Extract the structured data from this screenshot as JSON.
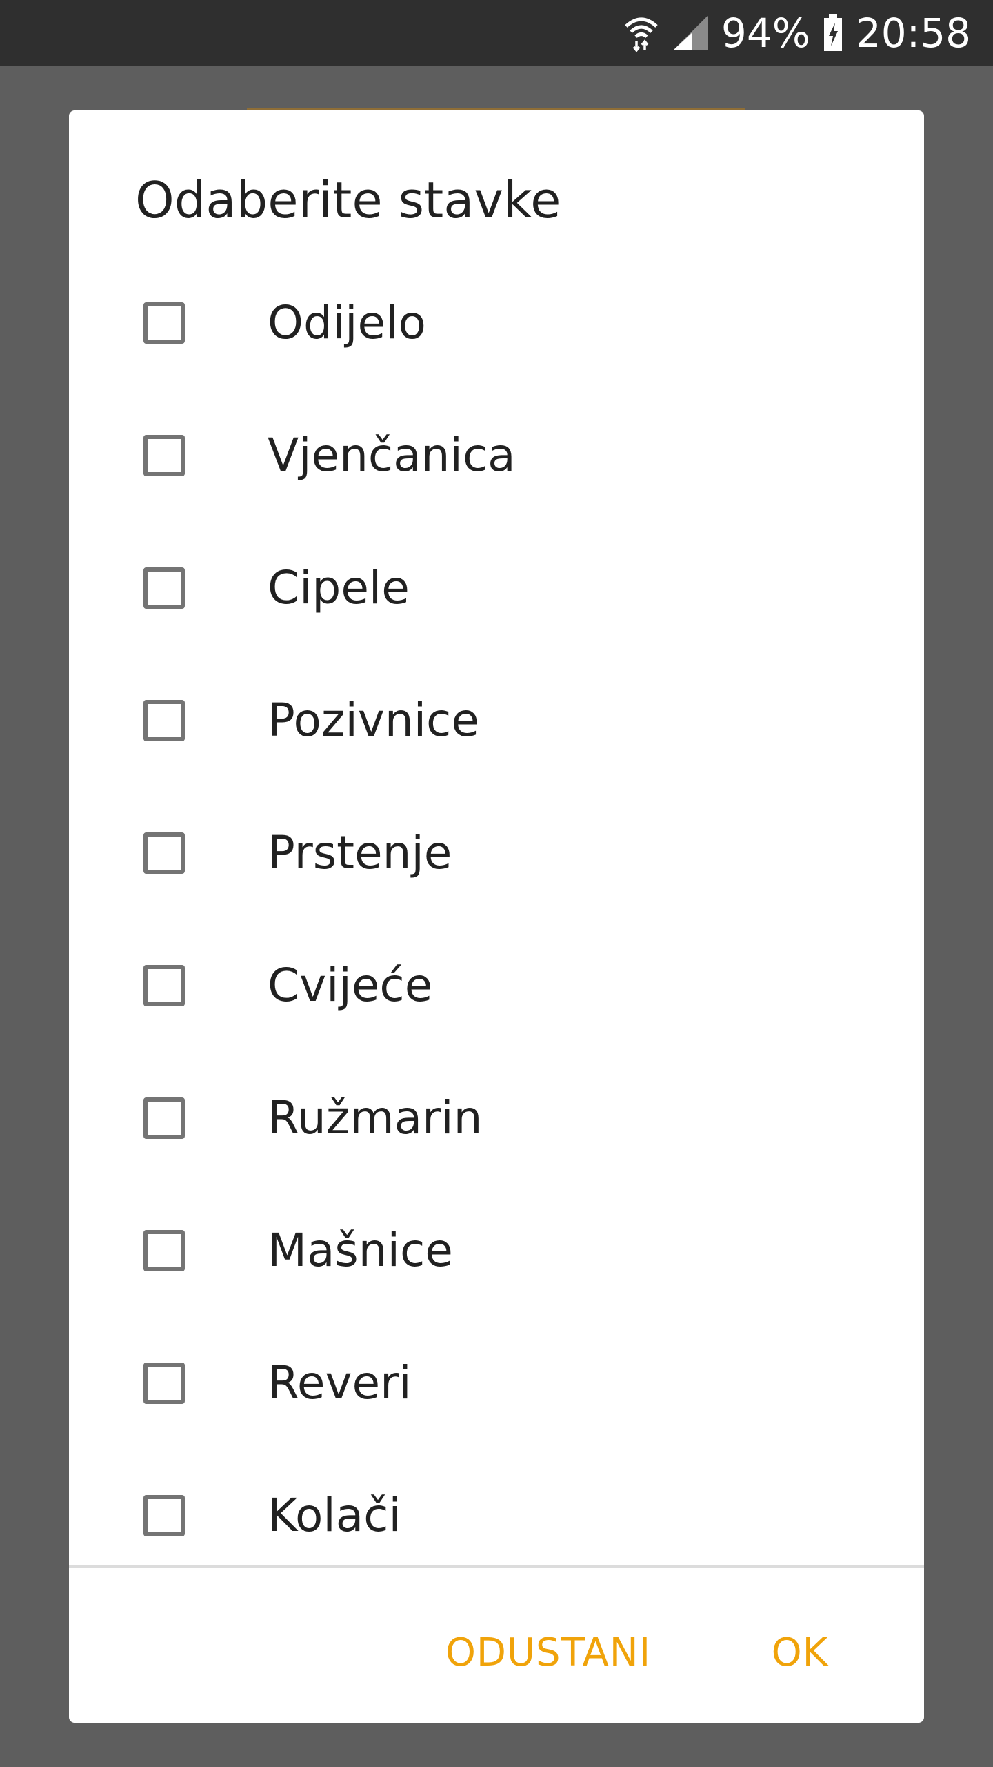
{
  "status_bar": {
    "battery": "94%",
    "time": "20:58",
    "icons": [
      "wifi-icon",
      "signal-icon",
      "battery-charging-icon"
    ]
  },
  "dialog": {
    "title": "Odaberite stavke",
    "items": [
      {
        "label": "Odijelo",
        "checked": false
      },
      {
        "label": "Vjenčanica",
        "checked": false
      },
      {
        "label": "Cipele",
        "checked": false
      },
      {
        "label": "Pozivnice",
        "checked": false
      },
      {
        "label": "Prstenje",
        "checked": false
      },
      {
        "label": "Cvijeće",
        "checked": false
      },
      {
        "label": "Ružmarin",
        "checked": false
      },
      {
        "label": "Mašnice",
        "checked": false
      },
      {
        "label": "Reveri",
        "checked": false
      },
      {
        "label": "Kolači",
        "checked": false
      }
    ],
    "cancel_label": "ODUSTANI",
    "ok_label": "OK"
  },
  "colors": {
    "accent": "#f0a30a",
    "status_bar": "#2f2f2f",
    "scrim": "#5e5e5e",
    "checkbox_border": "#747474",
    "text": "#212121"
  }
}
